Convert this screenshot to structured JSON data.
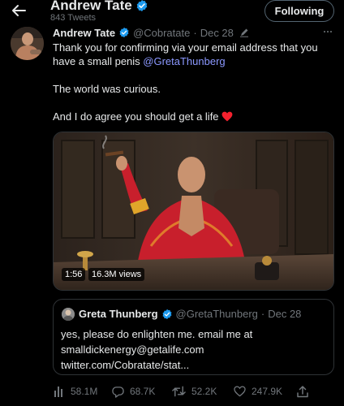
{
  "header": {
    "name": "Andrew Tate",
    "tweet_count": "843 Tweets",
    "follow_label": "Following"
  },
  "tweet": {
    "name": "Andrew Tate",
    "handle": "@Cobratate",
    "separator": "·",
    "date": "Dec 28",
    "line1": "Thank you for confirming via your email address that you",
    "line2_prefix": "have a small penis ",
    "line2_mention": "@GretaThunberg",
    "line3": "The world was curious.",
    "line4": "And I do agree you should get a life",
    "video_time": "1:56",
    "video_views": "16.3M views"
  },
  "quote": {
    "name": "Greta Thunberg",
    "handle": "@GretaThunberg",
    "separator": "·",
    "date": "Dec 28",
    "line1": "yes, please do enlighten me. email me at",
    "line2": "smalldickenergy@getalife.com",
    "line3": "twitter.com/Cobratate/stat..."
  },
  "actions": {
    "views": "58.1M",
    "replies": "68.7K",
    "retweets": "52.2K",
    "likes": "247.9K"
  },
  "icons": {
    "back": "back-arrow-icon",
    "verified": "verified-badge-icon",
    "edited": "edit-pencil-icon",
    "more": "more-icon",
    "heart_emoji": "red-heart-icon",
    "views": "views-chart-icon",
    "reply": "reply-icon",
    "retweet": "retweet-icon",
    "like": "like-icon",
    "share": "share-icon"
  },
  "colors": {
    "background": "#000000",
    "text": "#e7e9ea",
    "secondary": "#71767b",
    "verified": "#1d9bf0",
    "mention": "#8b98ff",
    "heart": "#f4212e"
  }
}
